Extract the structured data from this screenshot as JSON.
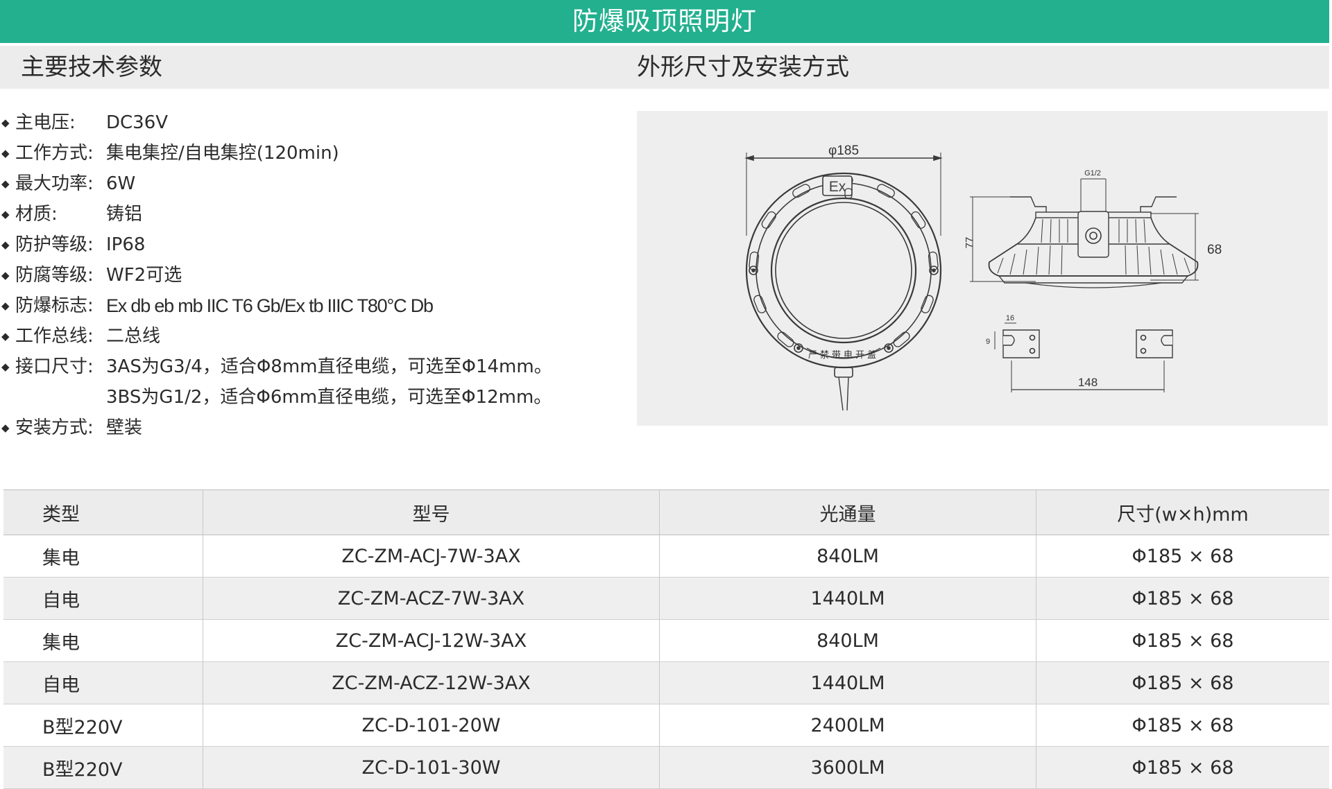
{
  "page": {
    "title": "防爆吸顶照明灯",
    "section_left": "主要技术参数",
    "section_right": "外形尺寸及安装方式"
  },
  "specs": [
    {
      "label": "主电压:",
      "value": "DC36V"
    },
    {
      "label": "工作方式:",
      "value": "集电集控/自电集控(120min)"
    },
    {
      "label": "最大功率:",
      "value": "6W"
    },
    {
      "label": "材质:",
      "value": "铸铝"
    },
    {
      "label": "防护等级:",
      "value": "IP68"
    },
    {
      "label": "防腐等级:",
      "value": "WF2可选"
    },
    {
      "label": "防爆标志:",
      "value": "Ex db eb mb IIC T6 Gb/Ex tb IIIC T80°C Db"
    },
    {
      "label": "工作总线:",
      "value": "二总线"
    },
    {
      "label": "接口尺寸:",
      "value": "3AS为G3/4，适合Φ8mm直径电缆，可选至Φ14mm。"
    },
    {
      "label": "",
      "value": "3BS为G1/2，适合Φ6mm直径电缆，可选至Φ12mm。"
    },
    {
      "label": "安装方式:",
      "value": "壁装"
    }
  ],
  "drawing": {
    "dim_diameter": "φ185",
    "dim_thread": "G1/2",
    "dim_height_total": "77",
    "dim_height_body": "68",
    "dim_hole": "16",
    "dim_slot": "9",
    "dim_spacing": "148",
    "ex_mark": "Ex",
    "plate_text": "严禁带电开盖"
  },
  "table": {
    "headers": [
      "类型",
      "型号",
      "光通量",
      "尺寸(w×h)mm"
    ],
    "rows": [
      [
        "集电",
        "ZC-ZM-ACJ-7W-3AX",
        "840LM",
        "Φ185 × 68"
      ],
      [
        "自电",
        "ZC-ZM-ACZ-7W-3AX",
        "1440LM",
        "Φ185 × 68"
      ],
      [
        "集电",
        "ZC-ZM-ACJ-12W-3AX",
        "840LM",
        "Φ185 × 68"
      ],
      [
        "自电",
        "ZC-ZM-ACZ-12W-3AX",
        "1440LM",
        "Φ185 × 68"
      ],
      [
        "B型220V",
        "ZC-D-101-20W",
        "2400LM",
        "Φ185 × 68"
      ],
      [
        "B型220V",
        "ZC-D-101-30W",
        "3600LM",
        "Φ185 × 68"
      ]
    ]
  },
  "colors": {
    "accent": "#22b08e",
    "band": "#ececec",
    "panel": "#eeeeee"
  }
}
